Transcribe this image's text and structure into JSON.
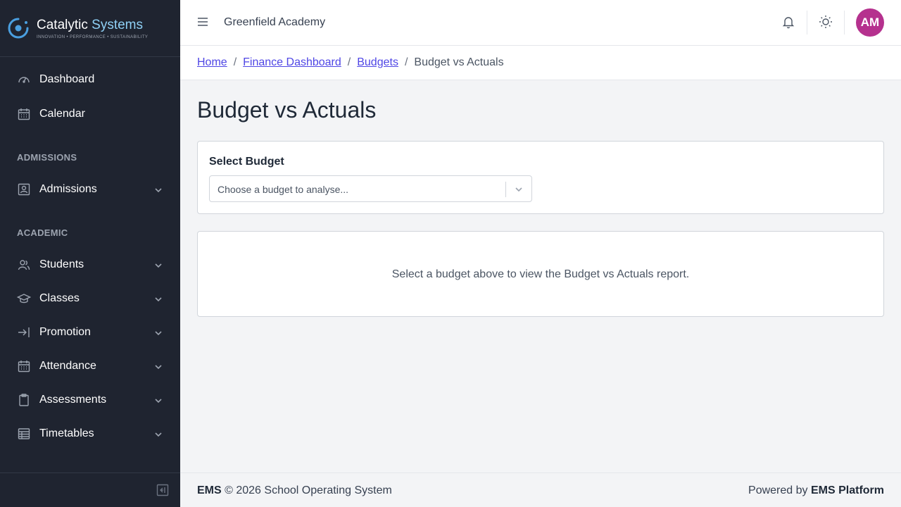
{
  "brand": {
    "name_part1": "Catalytic",
    "name_part2": "Systems",
    "tagline": "INNOVATION • PERFORMANCE • SUSTAINABILITY"
  },
  "sidebar": {
    "items": [
      {
        "label": "Dashboard",
        "icon": "speedometer-icon"
      },
      {
        "label": "Calendar",
        "icon": "calendar-icon"
      }
    ],
    "sections": [
      {
        "title": "ADMISSIONS",
        "items": [
          {
            "label": "Admissions",
            "icon": "id-card-icon"
          }
        ]
      },
      {
        "title": "ACADEMIC",
        "items": [
          {
            "label": "Students",
            "icon": "users-icon"
          },
          {
            "label": "Classes",
            "icon": "graduation-cap-icon"
          },
          {
            "label": "Promotion",
            "icon": "arrow-right-icon"
          },
          {
            "label": "Attendance",
            "icon": "calendar-check-icon"
          },
          {
            "label": "Assessments",
            "icon": "clipboard-icon"
          },
          {
            "label": "Timetables",
            "icon": "table-icon"
          }
        ]
      }
    ]
  },
  "topbar": {
    "school_name": "Greenfield Academy",
    "avatar_initials": "AM",
    "avatar_color": "#b5318e"
  },
  "breadcrumb": {
    "items": [
      "Home",
      "Finance Dashboard",
      "Budgets"
    ],
    "current": "Budget vs Actuals"
  },
  "main": {
    "title": "Budget vs Actuals",
    "select_label": "Select Budget",
    "select_placeholder": "Choose a budget to analyse...",
    "empty_message": "Select a budget above to view the Budget vs Actuals report."
  },
  "footer": {
    "brand": "EMS",
    "copyright": "© 2026 School Operating System",
    "powered_prefix": "Powered by",
    "powered_name": "EMS Platform"
  }
}
